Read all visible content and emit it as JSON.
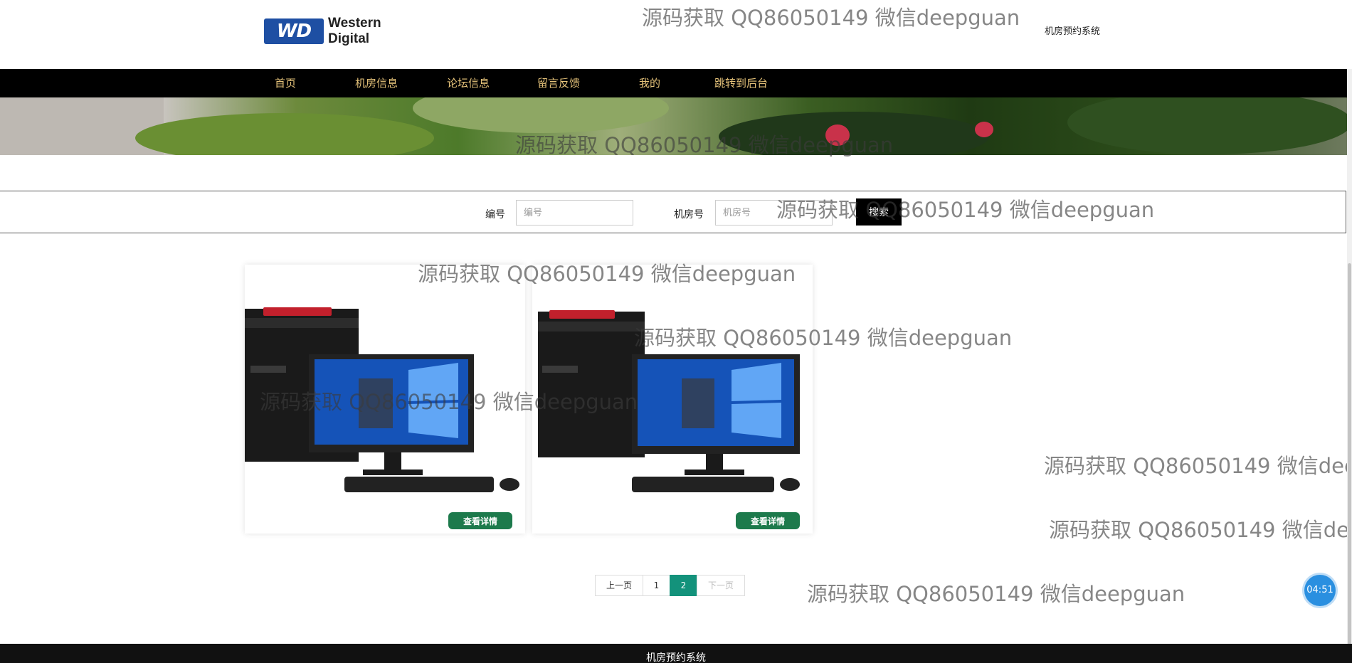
{
  "header": {
    "logo_mark": "WD",
    "logo_line1": "Western",
    "logo_line2": "Digital",
    "site_title": "机房预约系统"
  },
  "nav": {
    "items": [
      {
        "label": "首页"
      },
      {
        "label": "机房信息"
      },
      {
        "label": "论坛信息"
      },
      {
        "label": "留言反馈"
      },
      {
        "label": "我的"
      },
      {
        "label": "跳转到后台"
      }
    ]
  },
  "search": {
    "field1_label": "编号",
    "field1_placeholder": "编号",
    "field2_label": "机房号",
    "field2_placeholder": "机房号",
    "button_label": "搜索"
  },
  "cards": [
    {
      "button_label": "查看详情"
    },
    {
      "button_label": "查看详情"
    }
  ],
  "pagination": {
    "prev": "上一页",
    "pages": [
      "1",
      "2"
    ],
    "current": "2",
    "next": "下一页"
  },
  "watermark_text": "源码获取 QQ86050149 微信deepguan",
  "timer": "04:51",
  "footer": {
    "text": "机房预约系统"
  },
  "colors": {
    "nav_bg": "#000000",
    "nav_text": "#e6c37a",
    "detail_button": "#1d7a4c",
    "page_active": "#13927b",
    "timer_bg": "#2a8fe0"
  }
}
